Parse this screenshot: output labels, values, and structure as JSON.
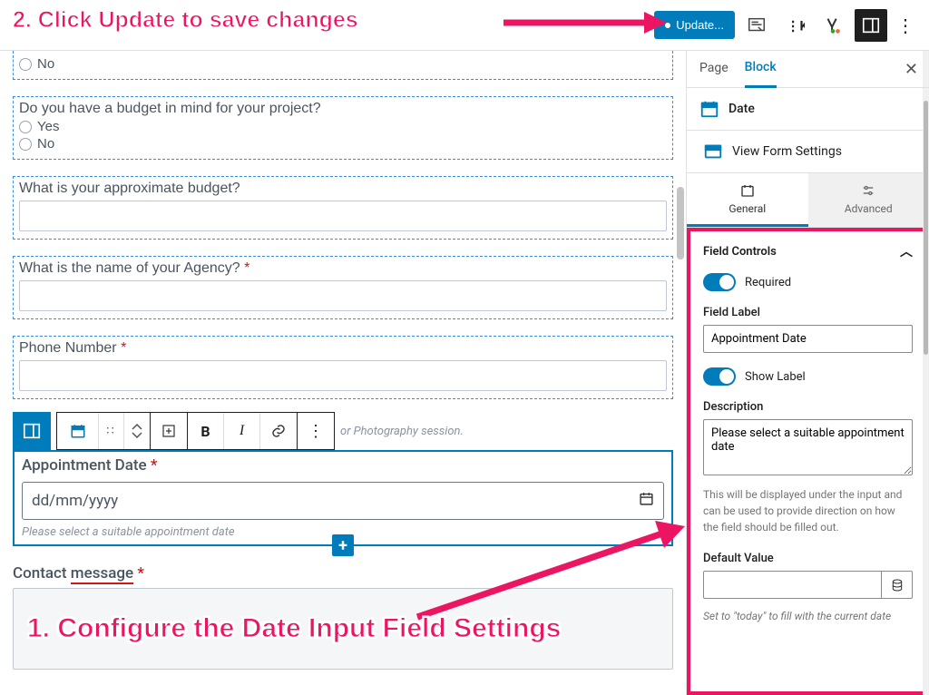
{
  "annotations": {
    "step2": "2. Click Update to save changes",
    "step1": "1. Configure the Date Input Field Settings"
  },
  "topbar": {
    "update_label": "Update..."
  },
  "editor": {
    "field_no_option": "No",
    "budget_question": "Do you have a budget in mind for your project?",
    "opt_yes": "Yes",
    "opt_no": "No",
    "approx_budget": "What is your approximate budget?",
    "agency_name": "What is the name of your Agency?",
    "phone_label": "Phone Number",
    "toolbar_trailing": "or Photography session.",
    "appt_label": "Appointment Date",
    "appt_placeholder": "dd/mm/yyyy",
    "appt_desc": "Please select a suitable appointment date",
    "contact_label_1": "Contact ",
    "contact_label_2": "message"
  },
  "sidebar": {
    "tab_page": "Page",
    "tab_block": "Block",
    "block_type": "Date",
    "view_form": "View Form Settings",
    "subtab_general": "General",
    "subtab_advanced": "Advanced",
    "panel": {
      "title": "Field Controls",
      "required_label": "Required",
      "field_label_title": "Field Label",
      "field_label_value": "Appointment Date",
      "show_label": "Show Label",
      "description_title": "Description",
      "description_value": "Please select a suitable appointment date",
      "description_help": "This will be displayed under the input and can be used to provide direction on how the field should be filled out.",
      "default_title": "Default Value",
      "default_value": "",
      "default_help": "Set to \"today\" to fill with the current date"
    }
  }
}
